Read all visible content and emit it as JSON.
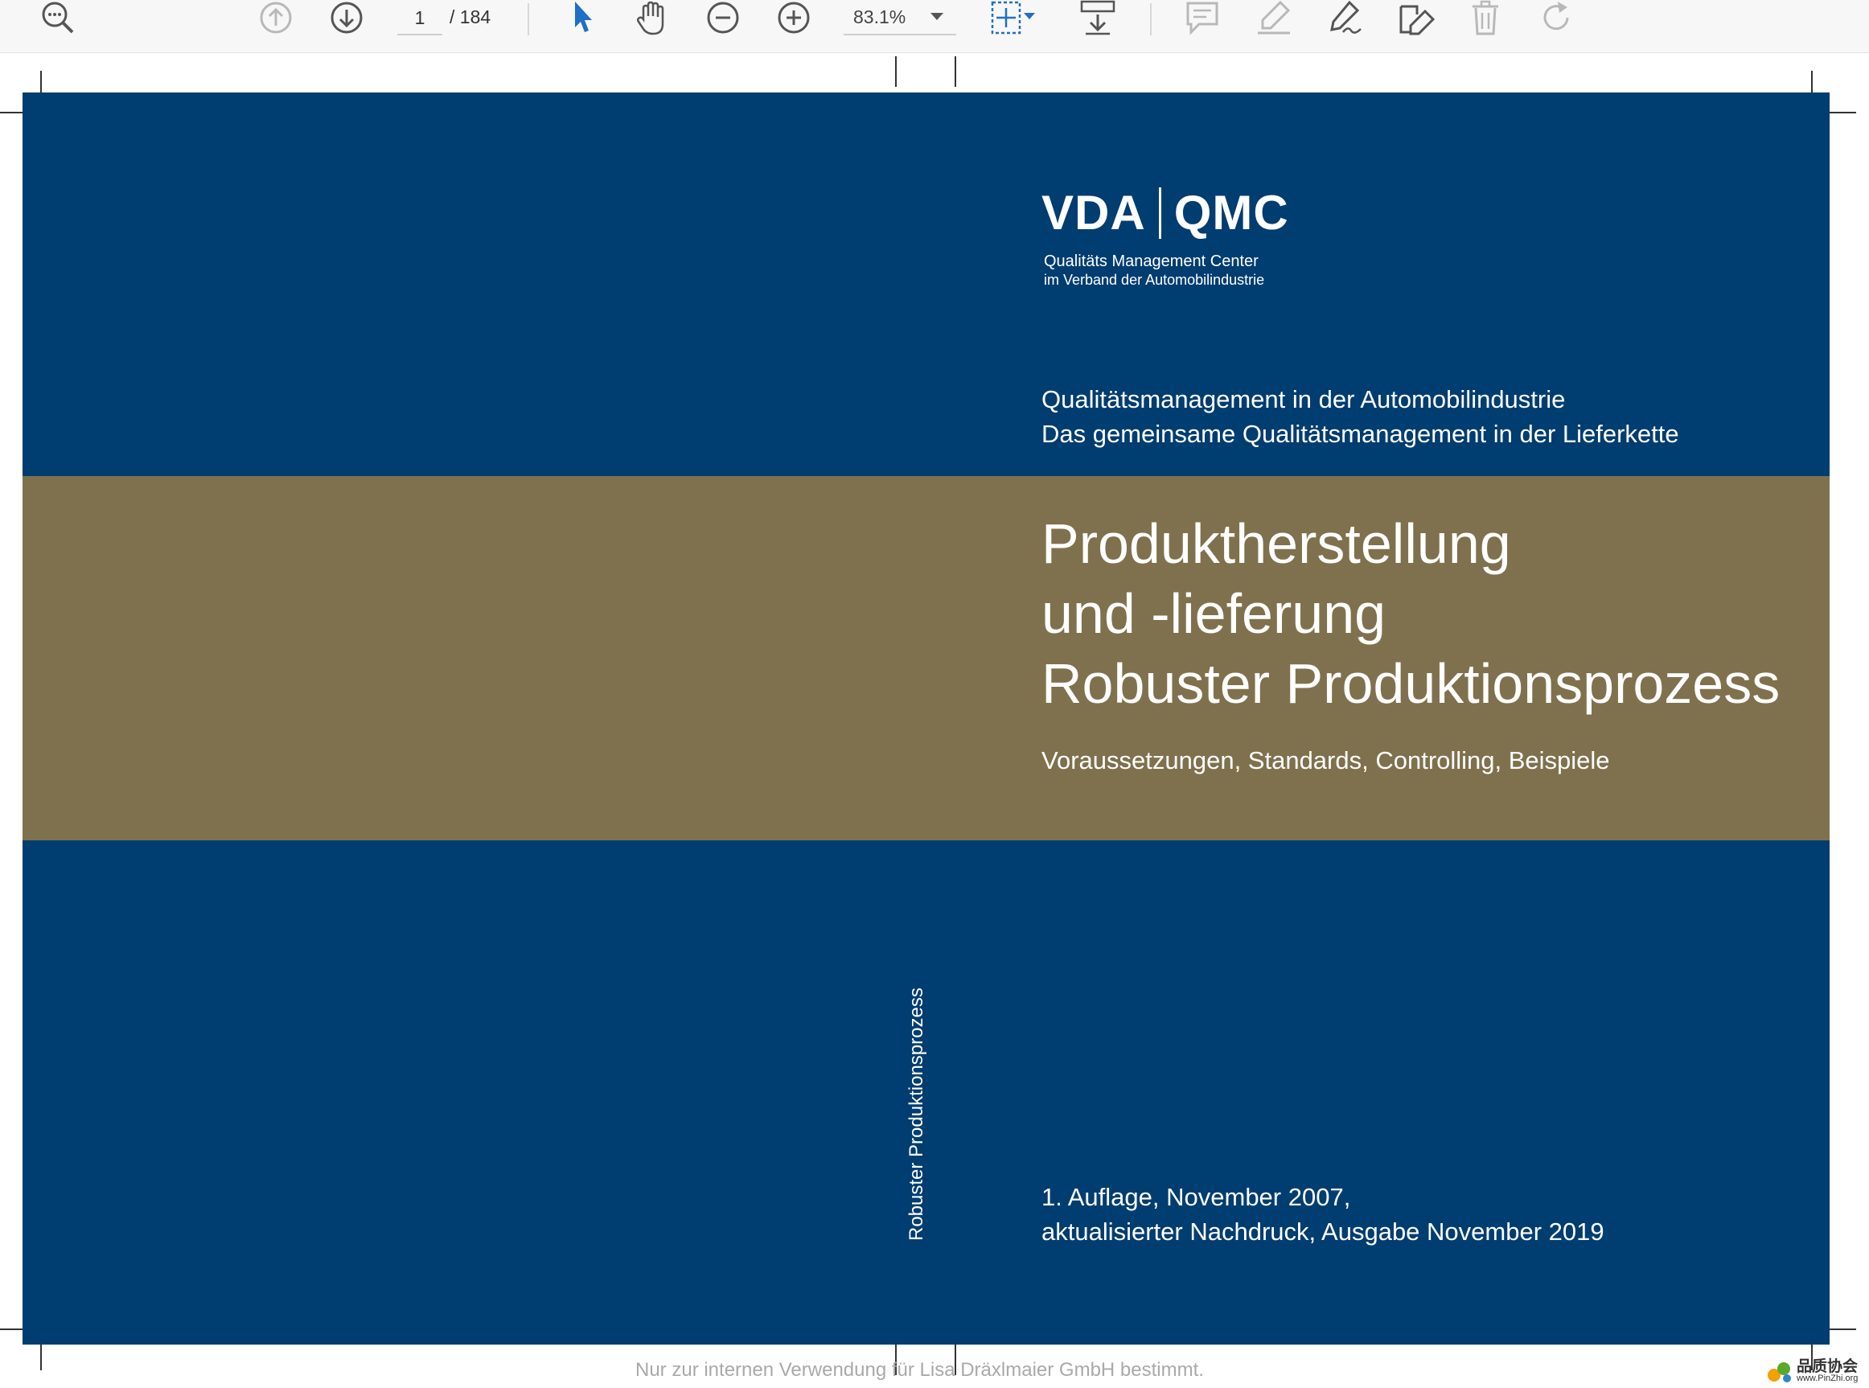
{
  "toolbar": {
    "current_page": "1",
    "total_pages": "/ 184",
    "zoom": "83.1%"
  },
  "cover": {
    "logo_left": "VDA",
    "logo_right": "QMC",
    "logo_sub_line1": "Qualitäts Management Center",
    "logo_sub_line2": "im Verband der Automobilindustrie",
    "subtitle_line1": "Qualitätsmanagement in der Automobilindustrie",
    "subtitle_line2": "Das gemeinsame Qualitätsmanagement in der Lieferkette",
    "title_line1": "Produktherstellung",
    "title_line2": "und -lieferung",
    "title_line3": "Robuster Produktionsprozess",
    "tagline": "Voraussetzungen, Standards, Controlling, Beispiele",
    "spine_text": "Robuster Produktionsprozess",
    "edition_line1": "1. Auflage, November 2007,",
    "edition_line2": "aktualisierter Nachdruck, Ausgabe November 2019",
    "colors": {
      "blue": "#003d70",
      "gold": "#7f714d"
    }
  },
  "watermark": "Nur zur internen Verwendung für Lisa Dräxlmaier GmbH bestimmt.",
  "corner_logo": {
    "name": "品质协会",
    "url": "www.PinZhi.org"
  }
}
